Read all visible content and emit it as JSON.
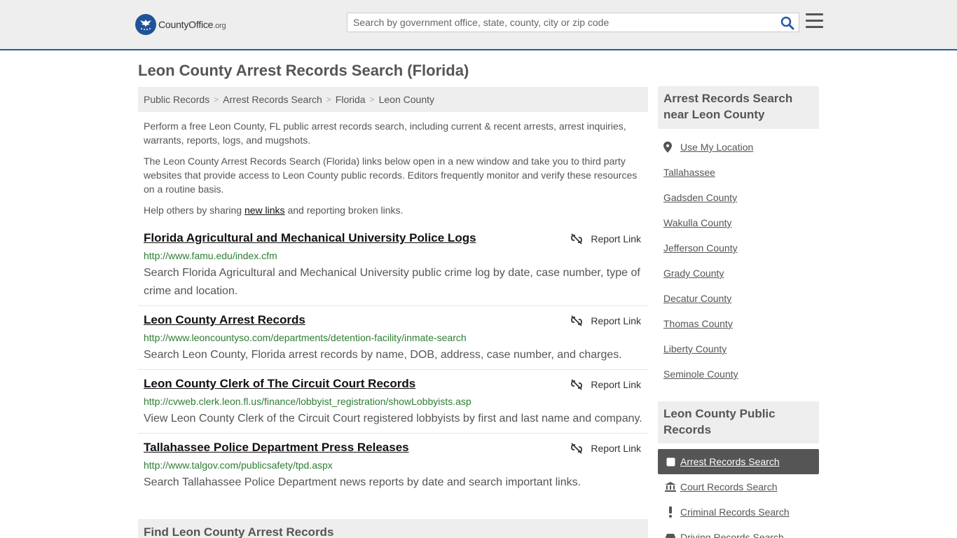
{
  "header": {
    "logo_text": "CountyOffice",
    "logo_tld": ".org",
    "search_placeholder": "Search by government office, state, county, city or zip code"
  },
  "page_title": "Leon County Arrest Records Search (Florida)",
  "breadcrumb": [
    "Public Records",
    "Arrest Records Search",
    "Florida",
    "Leon County"
  ],
  "intro": {
    "p1": "Perform a free Leon County, FL public arrest records search, including current & recent arrests, arrest inquiries, warrants, reports, logs, and mugshots.",
    "p2": "The Leon County Arrest Records Search (Florida) links below open in a new window and take you to third party websites that provide access to Leon County public records. Editors frequently monitor and verify these resources on a routine basis.",
    "p3_before": "Help others by sharing ",
    "p3_link": "new links",
    "p3_after": " and reporting broken links."
  },
  "report_label": "Report Link",
  "resources": [
    {
      "title": "Florida Agricultural and Mechanical University Police Logs",
      "url": "http://www.famu.edu/index.cfm",
      "desc": "Search Florida Agricultural and Mechanical University public crime log by date, case number, type of crime and location."
    },
    {
      "title": "Leon County Arrest Records",
      "url": "http://www.leoncountyso.com/departments/detention-facility/inmate-search",
      "desc": "Search Leon County, Florida arrest records by name, DOB, address, case number, and charges."
    },
    {
      "title": "Leon County Clerk of The Circuit Court Records",
      "url": "http://cvweb.clerk.leon.fl.us/finance/lobbyist_registration/showLobbyists.asp",
      "desc": "View Leon County Clerk of the Circuit Court registered lobbyists by first and last name and company."
    },
    {
      "title": "Tallahassee Police Department Press Releases",
      "url": "http://www.talgov.com/publicsafety/tpd.aspx",
      "desc": "Search Tallahassee Police Department news reports by date and search important links."
    }
  ],
  "find_heading": "Find Leon County Arrest Records",
  "sidebar": {
    "nearby_heading": "Arrest Records Search near Leon County",
    "use_location": "Use My Location",
    "nearby": [
      "Tallahassee",
      "Gadsden County",
      "Wakulla County",
      "Jefferson County",
      "Grady County",
      "Decatur County",
      "Thomas County",
      "Liberty County",
      "Seminole County"
    ],
    "public_heading": "Leon County Public Records",
    "public_records": [
      {
        "label": "Arrest Records Search",
        "icon": "square-icon",
        "active": true
      },
      {
        "label": "Court Records Search",
        "icon": "courthouse-icon",
        "active": false
      },
      {
        "label": "Criminal Records Search",
        "icon": "exclamation-icon",
        "active": false
      },
      {
        "label": "Driving Records Search",
        "icon": "car-icon",
        "active": false
      }
    ]
  },
  "colors": {
    "header_bg": "#eeeeee",
    "accent_border": "#2a5d9f",
    "url_green": "#2e7d32",
    "active_item_bg": "#555555"
  }
}
